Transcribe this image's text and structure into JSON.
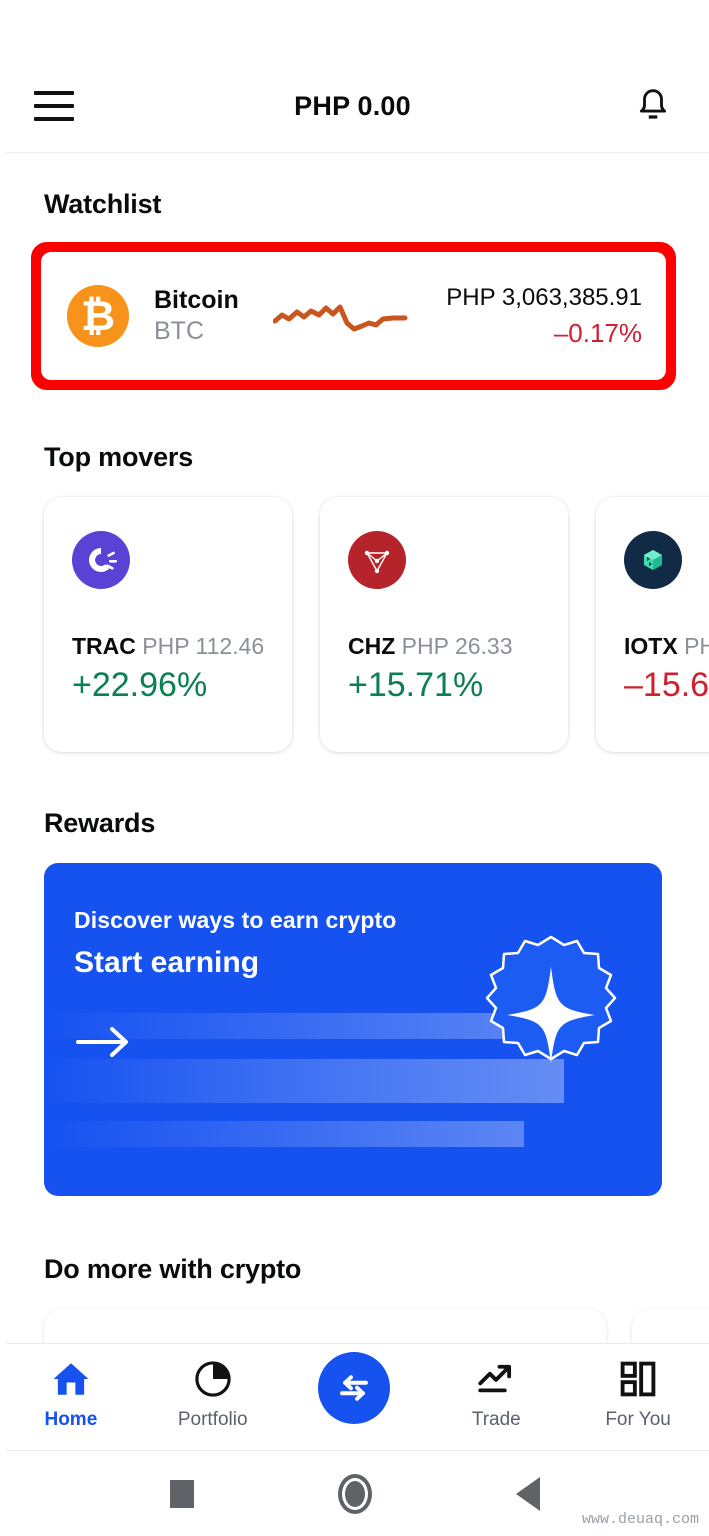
{
  "appbar": {
    "menu_icon": "hamburger-menu-icon",
    "title": "PHP 0.00",
    "notification_icon": "bell-icon"
  },
  "watchlist": {
    "heading": "Watchlist",
    "highlight_color": "#FF0000",
    "item": {
      "icon": "bitcoin-icon",
      "icon_color": "#F7931A",
      "glyph": "₿",
      "name": "Bitcoin",
      "symbol": "BTC",
      "sparkline_color": "#C8561E",
      "price": "PHP 3,063,385.91",
      "change": "–0.17%",
      "change_direction": "negative"
    }
  },
  "top_movers": {
    "heading": "Top movers",
    "cards": [
      {
        "icon": "origintrail-icon",
        "icon_color": "#5A43D4",
        "symbol": "TRAC",
        "price": "PHP 112.46",
        "change": "+22.96%",
        "change_direction": "positive"
      },
      {
        "icon": "chiliz-icon",
        "icon_color": "#B5242A",
        "symbol": "CHZ",
        "price": "PHP 26.33",
        "change": "+15.71%",
        "change_direction": "positive"
      },
      {
        "icon": "iotex-icon",
        "icon_color": "#112B46",
        "symbol": "IOTX",
        "price": "PH",
        "change": "–15.6",
        "change_direction": "negative"
      }
    ]
  },
  "rewards": {
    "heading": "Rewards",
    "banner": {
      "background_color": "#1652F0",
      "subtitle": "Discover ways to earn crypto",
      "title": "Start earning",
      "arrow_icon": "arrow-right-icon",
      "badge_icon": "sparkle-badge-icon"
    }
  },
  "do_more": {
    "heading": "Do more with crypto"
  },
  "bottom_nav": {
    "active": "Home",
    "items": [
      {
        "label": "Home",
        "icon": "home-icon"
      },
      {
        "label": "Portfolio",
        "icon": "pie-chart-icon"
      },
      {
        "label": "",
        "icon": "swap-arrows-icon"
      },
      {
        "label": "Trade",
        "icon": "trend-up-icon"
      },
      {
        "label": "For You",
        "icon": "grid-blocks-icon"
      }
    ],
    "accent_color": "#1652F0"
  },
  "system_bar": {
    "recents_icon": "square-recents-icon",
    "home_icon": "circle-home-icon",
    "back_icon": "triangle-back-icon"
  },
  "watermark": "www.deuaq.com"
}
